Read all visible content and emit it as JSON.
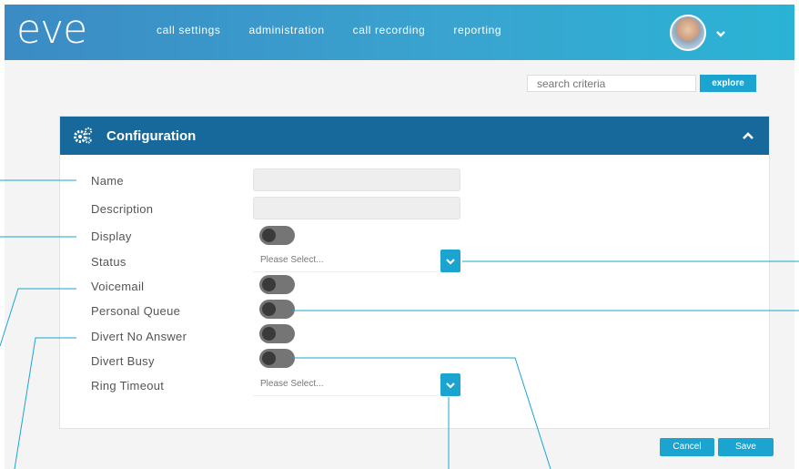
{
  "brand": {
    "logo_text": "eve",
    "accent": "#1ba4cf",
    "header_color": "#17699c"
  },
  "nav": {
    "items": [
      "call settings",
      "administration",
      "call recording",
      "reporting"
    ]
  },
  "search": {
    "placeholder": "search criteria",
    "explore_label": "explore"
  },
  "panel": {
    "title": "Configuration",
    "icon": "gears-icon",
    "fields": [
      {
        "label": "Name",
        "type": "text",
        "value": ""
      },
      {
        "label": "Description",
        "type": "text",
        "value": ""
      },
      {
        "label": "Display",
        "type": "toggle",
        "on": false
      },
      {
        "label": "Status",
        "type": "select",
        "value": "Please Select..."
      },
      {
        "label": "Voicemail",
        "type": "toggle",
        "on": false
      },
      {
        "label": "Personal Queue",
        "type": "toggle",
        "on": false
      },
      {
        "label": "Divert No Answer",
        "type": "toggle",
        "on": false
      },
      {
        "label": "Divert Busy",
        "type": "toggle",
        "on": false
      },
      {
        "label": "Ring Timeout",
        "type": "select",
        "value": "Please Select..."
      }
    ]
  },
  "actions": {
    "cancel_label": "Cancel",
    "save_label": "Save"
  }
}
